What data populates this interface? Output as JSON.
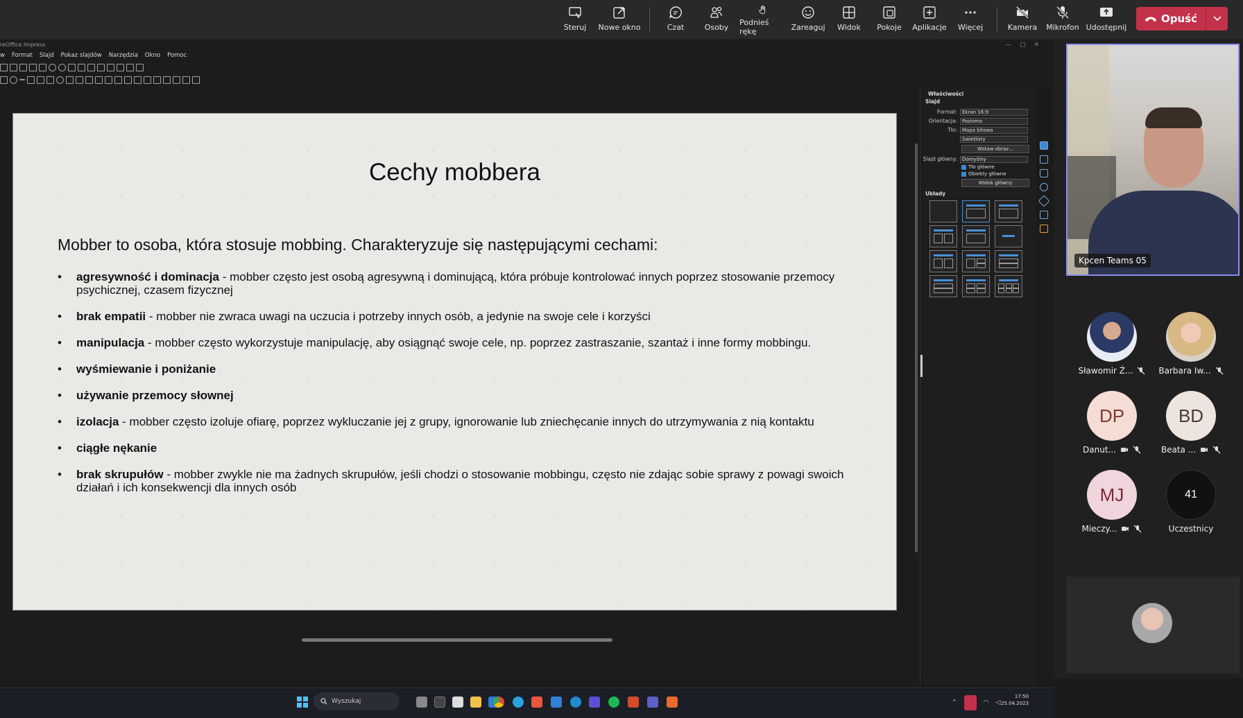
{
  "teams_toolbar": {
    "buttons": [
      {
        "label": "Steruj",
        "icon": "control-icon"
      },
      {
        "label": "Nowe okno",
        "icon": "popout-icon"
      },
      {
        "label": "Czat",
        "icon": "chat-icon"
      },
      {
        "label": "Osoby",
        "icon": "people-icon"
      },
      {
        "label": "Podnieś rękę",
        "icon": "raise-hand-icon"
      },
      {
        "label": "Zareaguj",
        "icon": "smiley-icon"
      },
      {
        "label": "Widok",
        "icon": "view-grid-icon"
      },
      {
        "label": "Pokoje",
        "icon": "rooms-icon"
      },
      {
        "label": "Aplikacje",
        "icon": "add-app-icon"
      },
      {
        "label": "Więcej",
        "icon": "more-icon"
      },
      {
        "label": "Kamera",
        "icon": "camera-off-icon"
      },
      {
        "label": "Mikrofon",
        "icon": "mic-off-icon"
      },
      {
        "label": "Udostępnij",
        "icon": "share-icon"
      }
    ],
    "leave_label": "Opuść",
    "leave_color": "#c4314b"
  },
  "impress": {
    "window_title": "reOffice Impress",
    "menu": [
      "w",
      "Format",
      "Slajd",
      "Pokaz slajdów",
      "Narzędzia",
      "Okno",
      "Pomoc"
    ]
  },
  "slide": {
    "title": "Cechy mobbera",
    "intro": "Mobber to osoba, która stosuje mobbing. Charakteryzuje się następującymi cechami:",
    "bullets": [
      {
        "term": "agresywność i dominacja",
        "desc": " - mobber często jest osobą agresywną i dominującą, która próbuje kontrolować innych poprzez stosowanie przemocy psychicznej, czasem fizycznej"
      },
      {
        "term": "brak empatii",
        "desc": " - mobber nie zwraca uwagi na uczucia i potrzeby innych osób, a jedynie na swoje cele i korzyści"
      },
      {
        "term": "manipulacja",
        "desc": " - mobber często wykorzystuje manipulację, aby osiągnąć swoje cele, np. poprzez zastraszanie, szantaż i inne formy mobbingu."
      },
      {
        "term": "wyśmiewanie i poniżanie",
        "desc": ""
      },
      {
        "term": "używanie przemocy słownej",
        "desc": ""
      },
      {
        "term": "izolacja",
        "desc": " - mobber często izoluje ofiarę, poprzez wykluczanie jej z grupy, ignorowanie lub zniechęcanie innych do utrzymywania z nią kontaktu"
      },
      {
        "term": "ciągłe nękanie",
        "desc": ""
      },
      {
        "term": "brak skrupułów",
        "desc": " - mobber zwykle nie ma żadnych skrupułów, jeśli chodzi o stosowanie mobbingu, często nie zdając sobie sprawy z powagi swoich działań i ich konsekwencji dla innych osób"
      }
    ]
  },
  "properties": {
    "header": "Właściwości",
    "slide_section": "Slajd",
    "format_label": "Format:",
    "format_value": "Ekran 16:9",
    "orientation_label": "Orientacja:",
    "orientation_value": "Poziomo",
    "background_label": "Tło:",
    "background_value": "Mapa bitowa",
    "background_sub": "Świetlisty",
    "insert_image_button": "Wstaw obraz...",
    "master_label": "Slajd główny:",
    "master_value": "Domyślny",
    "master_bg_check": "Tło główne",
    "master_obj_check": "Obiekty główne",
    "master_view_button": "Widok główny",
    "layouts_section": "Układy"
  },
  "taskbar": {
    "search_placeholder": "Wyszukaj",
    "time": "17:50",
    "date": "25.04.2023"
  },
  "participants": {
    "speaker_name": "Kpcen Teams 05",
    "list": [
      {
        "name": "Sławomir Ż...",
        "initials": "",
        "avatar_color": "#6b7ea8",
        "muted": true,
        "camera_off": false
      },
      {
        "name": "Barbara Iw...",
        "initials": "",
        "avatar_color": "#d8a88c",
        "muted": true,
        "camera_off": false
      },
      {
        "name": "Danut...",
        "initials": "DP",
        "avatar_color": "#f5dcd5",
        "muted": true,
        "camera_off": true
      },
      {
        "name": "Beata ...",
        "initials": "BD",
        "avatar_color": "#ede4e0",
        "muted": true,
        "camera_off": true
      },
      {
        "name": "Mieczy...",
        "initials": "MJ",
        "avatar_color": "#f0d6dc",
        "muted": true,
        "camera_off": true
      },
      {
        "name": "Uczestnicy",
        "initials": "41",
        "avatar_color": "#111111",
        "muted": false,
        "camera_off": false
      }
    ]
  }
}
